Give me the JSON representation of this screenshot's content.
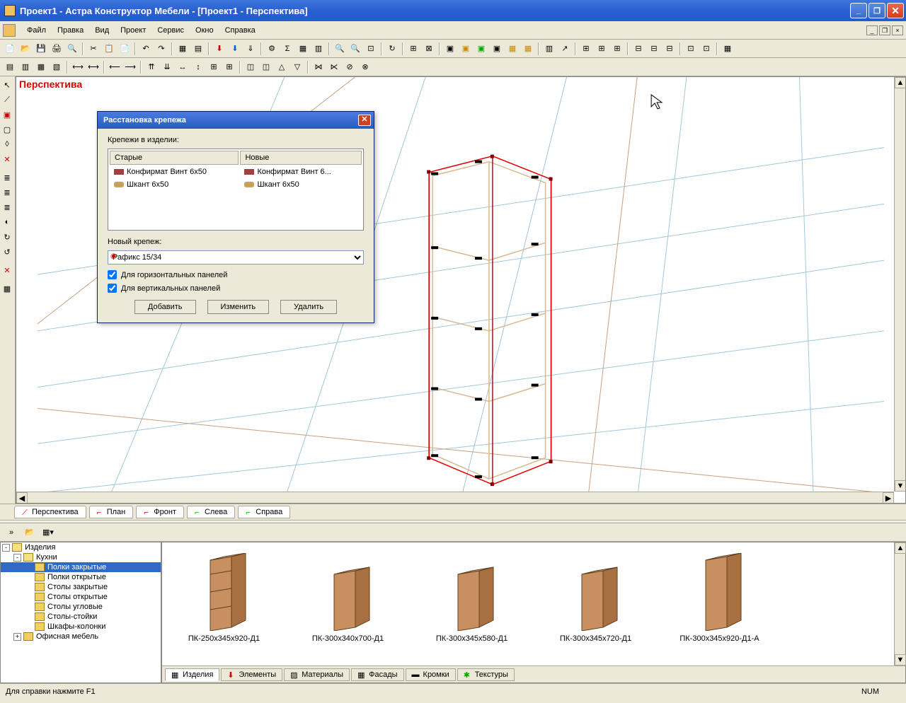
{
  "title": "Проект1 - Астра Конструктор Мебели - [Проект1 - Перспектива]",
  "menu": {
    "file": "Файл",
    "edit": "Правка",
    "view": "Вид",
    "project": "Проект",
    "service": "Сервис",
    "window": "Окно",
    "help": "Справка"
  },
  "viewport_label": "Перспектива",
  "view_tabs": {
    "perspective": "Перспектива",
    "plan": "План",
    "front": "Фронт",
    "left": "Слева",
    "right": "Справа"
  },
  "dialog": {
    "title": "Расстановка крепежа",
    "fasteners_label": "Крепежи в изделии:",
    "col_old": "Старые",
    "col_new": "Новые",
    "rows": [
      {
        "old": "Конфирмат Винт 6x50",
        "new": "Конфирмат Винт 6..."
      },
      {
        "old": "Шкант 6x50",
        "new": "Шкант 6x50"
      }
    ],
    "new_label": "Новый крепеж:",
    "select_value": "Рафикс 15/34",
    "check_h": "Для горизонтальных панелей",
    "check_v": "Для вертикальных панелей",
    "btn_add": "Добавить",
    "btn_edit": "Изменить",
    "btn_delete": "Удалить"
  },
  "tree": {
    "root": "Изделия",
    "kitchen": "Кухни",
    "items": [
      "Полки закрытые",
      "Полки открытые",
      "Столы закрытые",
      "Столы открытые",
      "Столы угловые",
      "Столы-стойки",
      "Шкафы-колонки"
    ],
    "office": "Офисная мебель"
  },
  "thumbs": [
    "ПК-250х345х920-Д1",
    "ПК-300х340х700-Д1",
    "ПК-300х345х580-Д1",
    "ПК-300х345х720-Д1",
    "ПК-300х345х920-Д1-А"
  ],
  "bottom_tabs": {
    "products": "Изделия",
    "elements": "Элементы",
    "materials": "Материалы",
    "facades": "Фасады",
    "edges": "Кромки",
    "textures": "Текстуры"
  },
  "status": {
    "help": "Для справки нажмите F1",
    "num": "NUM"
  }
}
